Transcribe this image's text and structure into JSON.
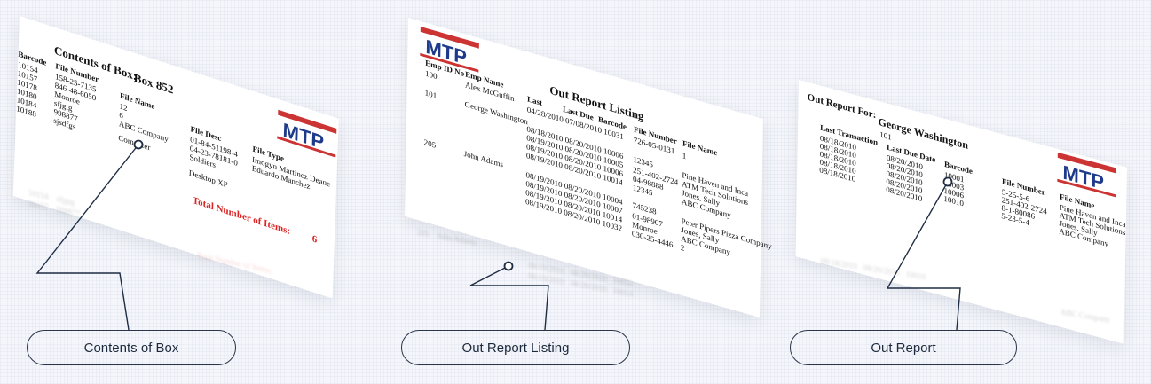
{
  "panel1": {
    "title": "Contents of Box:",
    "box_label": "Box 852",
    "col_barcode": "Barcode",
    "col_file_number": "File Number",
    "col_file_name": "File Name",
    "col_file_desc": "File Desc",
    "col_file_type": "File Type",
    "barcodes": [
      "10154",
      "10157",
      "10178",
      "10180",
      "10184",
      "10188"
    ],
    "file_numbers": [
      "158-25-7135",
      "846-48-6050",
      "Monroe",
      "sfjgtg",
      "998877",
      "sjsdfgs"
    ],
    "file_names": [
      "12",
      "6",
      "ABC Company",
      "Computer"
    ],
    "file_descs": [
      "01-84-51198-4",
      "04-23-78181-0",
      "Soldiers",
      "Desktop XP"
    ],
    "file_types": [
      "Imogyn Martinez Deane",
      "Eduardo Manchez"
    ],
    "total_label": "Total Number of Items:",
    "total_value": "6",
    "logo_text": "MTP"
  },
  "panel2": {
    "title": "Out Report Listing",
    "col_emp_id": "Emp ID No",
    "col_emp_name": "Emp Name",
    "col_last": "Last",
    "col_last_due": "Last Due",
    "col_barcode": "Barcode",
    "col_file_number": "File Number",
    "col_file_name": "File Name",
    "emp_ids": [
      "100",
      "101",
      "205"
    ],
    "emp_names": [
      "Alex McGuffin",
      "George Washington",
      "John Adams"
    ],
    "rows": [
      "04/28/2010   07/08/2010   10031",
      "08/18/2010   08/20/2010   10006",
      "08/19/2010   08/20/2010   10005",
      "08/19/2010   08/20/2010   10006",
      "08/19/2010   08/20/2010   10014",
      "08/19/2010   08/20/2010   10004",
      "08/19/2010   08/20/2010   10007",
      "08/19/2010   08/20/2010   10014",
      "08/19/2010   08/20/2010   10032"
    ],
    "file_numbers": [
      "726-05-0131",
      "12345",
      "251-402-2724",
      "04-98888",
      "12345",
      "745238",
      "01-98907",
      "Monroe",
      "030-25-4446"
    ],
    "file_names": [
      "1",
      "Pine Haven and Inca",
      "ATM Tech Solutions",
      "Jones, Sally",
      "ABC Company",
      "Peter Pipers Pizza Company",
      "Jones, Sally",
      "ABC Company",
      "2"
    ],
    "logo_text": "MTP"
  },
  "panel3": {
    "title": "Out Report For:",
    "name": "George Washington",
    "id": "101",
    "col_last_transaction": "Last Transaction",
    "col_last_due_date": "Last Due Date",
    "col_barcode": "Barcode",
    "col_file_number": "File Number",
    "col_file_name": "File Name",
    "transactions": [
      "08/18/2010",
      "08/18/2010",
      "08/18/2010",
      "08/18/2010",
      "08/18/2010"
    ],
    "due_dates": [
      "08/20/2010",
      "08/20/2010",
      "08/20/2010",
      "08/20/2010",
      "08/20/2010"
    ],
    "barcodes": [
      "10001",
      "10003",
      "10006",
      "10010"
    ],
    "file_numbers": [
      "5-25-5-6",
      "251-402-2724",
      "8-1-80086",
      "5-23-5-4"
    ],
    "file_names": [
      "Pine Haven and Inca",
      "ATM Tech Solutions",
      "Jones, Sally",
      "ABC Company"
    ],
    "logo_text": "MTP"
  },
  "callouts": {
    "contents_of_box": "Contents of Box",
    "out_report_listing": "Out Report Listing",
    "out_report": "Out Report"
  },
  "colors": {
    "line": "#1f2d44",
    "accent_red": "#d22222",
    "logo_blue": "#1e3a8a"
  }
}
